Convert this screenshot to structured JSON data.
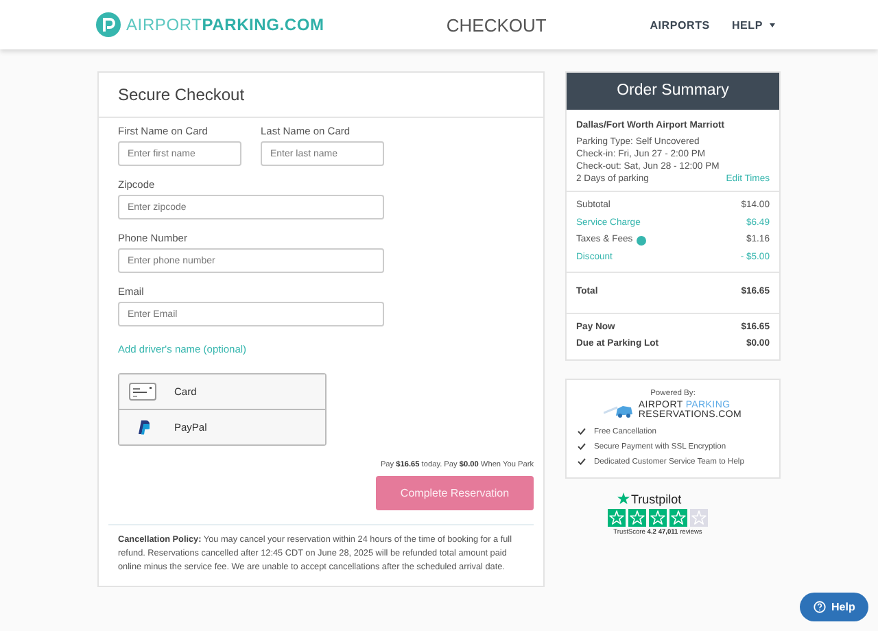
{
  "header": {
    "logo": "AIRPORT**PARKING.COM**",
    "title": "CHECKOUT",
    "nav": [
      {
        "label": "AIRPORTS",
        "dropdown": false
      },
      {
        "label": "HELP",
        "dropdown": true
      }
    ]
  },
  "checkout": {
    "title": "Secure Checkout",
    "field_rows": [
      [
        {
          "label": "First Name on Card",
          "placeholder": "Enter first name"
        },
        {
          "label": "Last Name on Card",
          "placeholder": "Enter last name"
        }
      ],
      [
        {
          "label": "Zipcode",
          "placeholder": "Enter zipcode"
        }
      ],
      [
        {
          "label": "Phone Number",
          "placeholder": "Enter phone number"
        }
      ],
      [
        {
          "label": "Email",
          "placeholder": "Enter Email"
        }
      ]
    ],
    "driver_link": "Add driver's name (optional)",
    "payment_methods": [
      {
        "kind": "card",
        "label": "Card"
      },
      {
        "kind": "paypal",
        "label": "PayPal"
      }
    ],
    "pay_note": "Pay **$16.65** today. Pay **$0.00** When You Park",
    "submit": "Complete Reservation",
    "policy": "**Cancellation Policy:** You may cancel your reservation within 24 hours of the time of booking for a full refund. Reservations cancelled after 12:45 CDT on June 28, 2025 will be refunded total amount paid online minus the service fee. We are unable to accept cancellations after the scheduled arrival date."
  },
  "summary": {
    "title": "Order Summary",
    "location": "Dallas/Fort Worth Airport Marriott",
    "details": [
      "Parking Type: Self Uncovered",
      "Check-in: Fri, Jun 27 - 2:00 PM",
      "Check-out: Sat, Jun 28 - 12:00 PM",
      "2 Days of parking"
    ],
    "edit_link": "Edit Times",
    "sections": [
      [
        {
          "label": "Subtotal",
          "value": "$14.00",
          "kind": "plain",
          "info": false
        },
        {
          "label": "Service Charge",
          "value": "$6.49",
          "kind": "accent",
          "info": false
        },
        {
          "label": "Taxes & Fees",
          "value": "$1.16",
          "kind": "plain",
          "info": true
        },
        {
          "label": "Discount",
          "value": "- $5.00",
          "kind": "accent",
          "info": false
        }
      ],
      [
        {
          "label": "Total",
          "value": "$16.65",
          "kind": "bold",
          "info": false
        }
      ],
      [
        {
          "label": "Pay Now",
          "value": "$16.65",
          "kind": "bold",
          "info": false
        },
        {
          "label": "Due at Parking Lot",
          "value": "$0.00",
          "kind": "bold",
          "info": false
        }
      ]
    ]
  },
  "powered": {
    "caption": "Powered By:",
    "logo_lines": [
      "AIRPORT *PARKING*",
      "RESERVATIONS.COM"
    ],
    "features": [
      "Free Cancellation",
      "Secure Payment with SSL Encryption",
      "Dedicated Customer Service Team to Help"
    ]
  },
  "trustpilot": {
    "brand": "Trustpilot",
    "stars": 4,
    "score": "TrustScore **4.2** **47,011** reviews"
  },
  "help_button": "Help"
}
